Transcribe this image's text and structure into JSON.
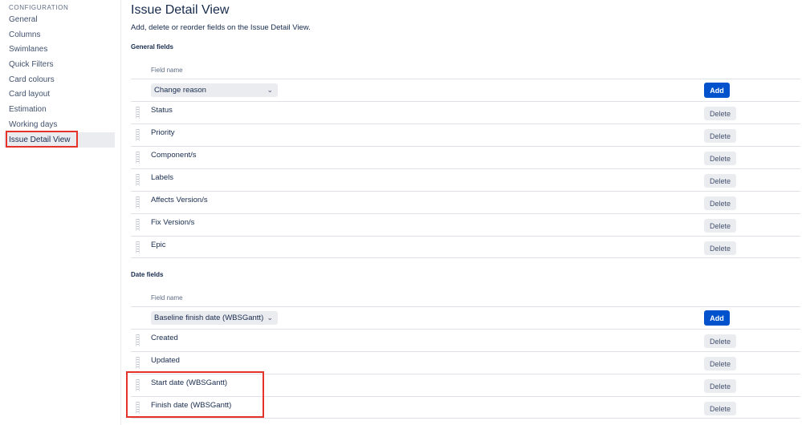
{
  "sidebar": {
    "heading": "CONFIGURATION",
    "items": [
      {
        "label": "General"
      },
      {
        "label": "Columns"
      },
      {
        "label": "Swimlanes"
      },
      {
        "label": "Quick Filters"
      },
      {
        "label": "Card colours"
      },
      {
        "label": "Card layout"
      },
      {
        "label": "Estimation"
      },
      {
        "label": "Working days"
      },
      {
        "label": "Issue Detail View",
        "active": true
      }
    ]
  },
  "page": {
    "title": "Issue Detail View",
    "description": "Add, delete or reorder fields on the Issue Detail View."
  },
  "general": {
    "section_title": "General fields",
    "column_header": "Field name",
    "select_value": "Change reason",
    "add_label": "Add",
    "fields": [
      "Status",
      "Priority",
      "Component/s",
      "Labels",
      "Affects Version/s",
      "Fix Version/s",
      "Epic"
    ],
    "delete_label": "Delete"
  },
  "dates": {
    "section_title": "Date fields",
    "column_header": "Field name",
    "select_value": "Baseline finish date (WBSGantt)",
    "add_label": "Add",
    "fields": [
      "Created",
      "Updated",
      "Start date (WBSGantt)",
      "Finish date (WBSGantt)"
    ],
    "delete_label": "Delete"
  },
  "colors": {
    "primary": "#0052cc",
    "highlight": "#e5332a",
    "text": "#172b4d",
    "subtle": "#ebecf0"
  }
}
